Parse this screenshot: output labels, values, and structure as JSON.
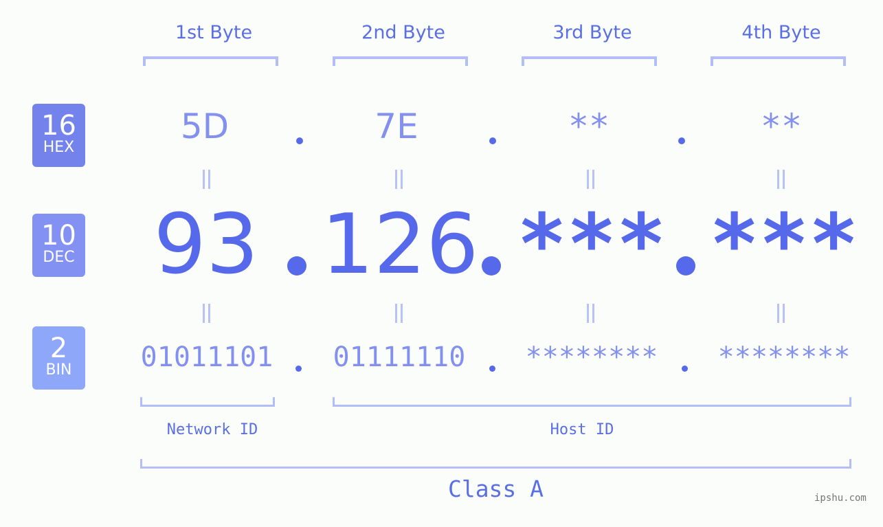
{
  "bytes": [
    {
      "label": "1st Byte",
      "hex": "5D",
      "dec": "93",
      "bin": "01011101"
    },
    {
      "label": "2nd Byte",
      "hex": "7E",
      "dec": "126",
      "bin": "01111110"
    },
    {
      "label": "3rd Byte",
      "hex": "**",
      "dec": "***",
      "bin": "********"
    },
    {
      "label": "4th Byte",
      "hex": "**",
      "dec": "***",
      "bin": "********"
    }
  ],
  "badges": {
    "hex": {
      "num": "16",
      "label": "HEX",
      "color": "#7483ec"
    },
    "dec": {
      "num": "10",
      "label": "DEC",
      "color": "#8392f2"
    },
    "bin": {
      "num": "2",
      "label": "BIN",
      "color": "#8ea7f9"
    }
  },
  "segments": {
    "network": "Network ID",
    "host": "Host ID",
    "class": "Class A"
  },
  "watermark": "ipshu.com",
  "colors": {
    "accent": "#5569ea",
    "light": "#8390ee",
    "bracket": "#b3bdf7"
  }
}
